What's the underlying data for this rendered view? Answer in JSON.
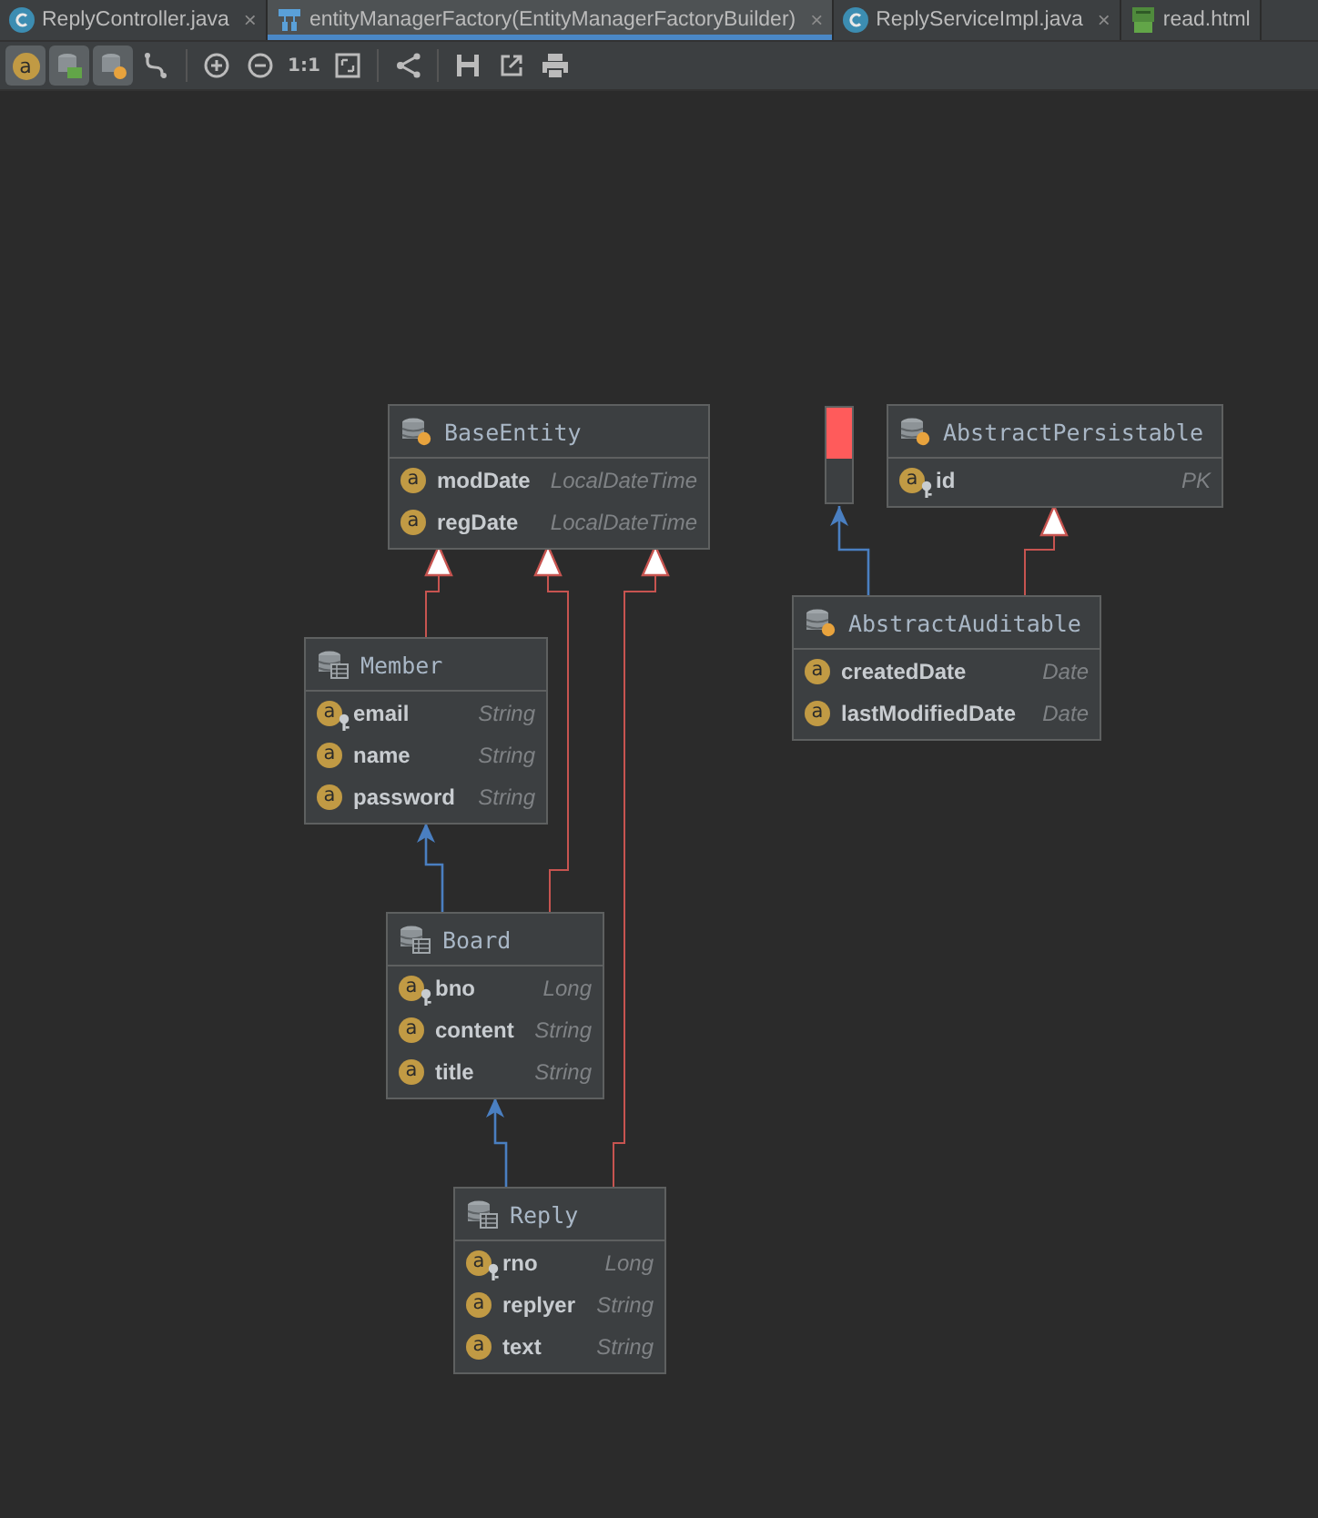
{
  "tabs": [
    {
      "kind": "class",
      "label": "ReplyController.java",
      "close": "×",
      "selected": false
    },
    {
      "kind": "diagram",
      "label": "entityManagerFactory(EntityManagerFactoryBuilder)",
      "close": "×",
      "selected": true
    },
    {
      "kind": "class",
      "label": "ReplyServiceImpl.java",
      "close": "×",
      "selected": false
    },
    {
      "kind": "html",
      "label": "read.html",
      "selected": false
    }
  ],
  "toolbar": [
    {
      "kind": "fields",
      "label": "a",
      "on": true
    },
    {
      "kind": "table",
      "on": true
    },
    {
      "kind": "entity",
      "on": true
    },
    {
      "kind": "route",
      "on": false
    },
    {
      "kind": "separator"
    },
    {
      "kind": "zoom_in",
      "on": false
    },
    {
      "kind": "zoom_out",
      "on": false
    },
    {
      "kind": "actual_size",
      "label": "1:1",
      "on": false
    },
    {
      "kind": "fit",
      "on": false
    },
    {
      "kind": "separator"
    },
    {
      "kind": "layout",
      "on": false
    },
    {
      "kind": "separator"
    },
    {
      "kind": "save",
      "on": false
    },
    {
      "kind": "export",
      "on": false
    },
    {
      "kind": "print",
      "on": false
    }
  ],
  "diagram": {
    "nodes": [
      {
        "kind": "mapped_superclass",
        "name": "BaseEntity",
        "fields": [
          {
            "badge": "a",
            "key": false,
            "name": "modDate",
            "type": "LocalDateTime"
          },
          {
            "badge": "a",
            "key": false,
            "name": "regDate",
            "type": "LocalDateTime"
          }
        ]
      },
      {
        "kind": "mapped_superclass",
        "name": "AbstractPersistable",
        "fields": [
          {
            "badge": "a",
            "key": true,
            "name": "id",
            "type": "PK"
          }
        ]
      },
      {
        "kind": "entity",
        "name": "Member",
        "fields": [
          {
            "badge": "a",
            "key": true,
            "name": "email",
            "type": "String"
          },
          {
            "badge": "a",
            "key": false,
            "name": "name",
            "type": "String"
          },
          {
            "badge": "a",
            "key": false,
            "name": "password",
            "type": "String"
          }
        ]
      },
      {
        "kind": "mapped_superclass",
        "name": "AbstractAuditable",
        "fields": [
          {
            "badge": "a",
            "key": false,
            "name": "createdDate",
            "type": "Date"
          },
          {
            "badge": "a",
            "key": false,
            "name": "lastModifiedDate",
            "type": "Date"
          }
        ]
      },
      {
        "kind": "entity",
        "name": "Board",
        "fields": [
          {
            "badge": "a",
            "key": true,
            "name": "bno",
            "type": "Long"
          },
          {
            "badge": "a",
            "key": false,
            "name": "content",
            "type": "String"
          },
          {
            "badge": "a",
            "key": false,
            "name": "title",
            "type": "String"
          }
        ]
      },
      {
        "kind": "entity",
        "name": "Reply",
        "fields": [
          {
            "badge": "a",
            "key": true,
            "name": "rno",
            "type": "Long"
          },
          {
            "badge": "a",
            "key": false,
            "name": "replyer",
            "type": "String"
          },
          {
            "badge": "a",
            "key": false,
            "name": "text",
            "type": "String"
          }
        ]
      }
    ]
  }
}
